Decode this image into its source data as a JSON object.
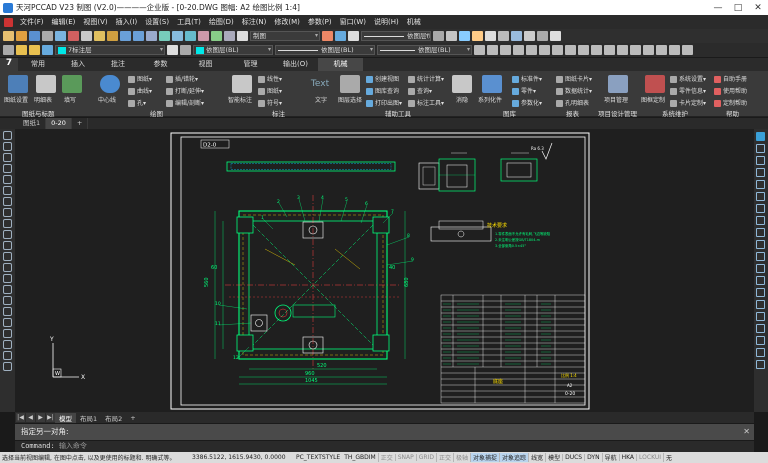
{
  "window": {
    "title": "天河PCCAD V23 制图 (V2.0)————企业版 - [0-20.DWG 图幅: A2 绘图比例 1:4]",
    "minimize": "—",
    "maximize": "□",
    "close": "✕"
  },
  "menu": [
    "文件(F)",
    "编辑(E)",
    "视图(V)",
    "插入(I)",
    "设置(S)",
    "工具(T)",
    "绘图(D)",
    "标注(N)",
    "修改(M)",
    "参数(P)",
    "窗口(W)",
    "说明(H)",
    "机械"
  ],
  "toolbar": {
    "layer_combo": "7标注层",
    "color_combo": "依图层(BL)",
    "linetype_combo": "依图层(BL)",
    "linetype2_combo": "依图层(BL)",
    "style_combo": "制图",
    "lineweight_combo": "依图层(BL)"
  },
  "ribbon_tabs": [
    "常用",
    "插入",
    "批注",
    "参数",
    "视图",
    "管理",
    "输出(O)",
    "机械"
  ],
  "ribbon_active_tab": "机械",
  "ribbon_groups": [
    {
      "label": "图纸与标题",
      "buttons": [
        {
          "label": "图纸设置"
        },
        {
          "label": "明细表"
        },
        {
          "label": "填写"
        }
      ]
    },
    {
      "label": "绘图",
      "buttons": [
        {
          "label": "中心线"
        }
      ],
      "small": [
        "图纸▾",
        "曲线▾",
        "孔▾",
        "插/错轮▾",
        "打断/延伸▾",
        "编辑/剖断▾"
      ]
    },
    {
      "label": "标注",
      "buttons": [
        {
          "label": "智能标注"
        },
        {
          "label": "文字"
        }
      ],
      "small": [
        "线性▾",
        "图纸▾",
        "符号▾"
      ]
    },
    {
      "label": "辅助工具",
      "buttons": [
        {
          "label": "图层选择"
        }
      ],
      "small": [
        "创建视图",
        "图库查询",
        "打印出图▾",
        "统计计算▾",
        "查询▾",
        "标注工具▾"
      ]
    },
    {
      "label": "图库",
      "buttons": [
        {
          "label": "消隐"
        },
        {
          "label": "系列化件"
        }
      ],
      "small": [
        "标准件▾",
        "零件▾",
        "参数化▾"
      ]
    },
    {
      "label": "报表",
      "small": [
        "图纸卡片▾",
        "数据统计▾",
        "孔明细表"
      ]
    },
    {
      "label": "项目设计管理",
      "buttons": [
        {
          "label": "项目管理"
        }
      ]
    },
    {
      "label": "系统维护",
      "buttons": [
        {
          "label": "图框定制"
        }
      ],
      "small": [
        "系统设置▾",
        "零件信息▾",
        "卡片定制▾"
      ]
    },
    {
      "label": "帮助",
      "small": [
        "自助手册",
        "使用帮助",
        "定制帮助"
      ]
    }
  ],
  "doc_tabs": [
    "图纸1",
    "0-20",
    "+"
  ],
  "doc_active_tab": "0-20",
  "layout_tabs": [
    "模型",
    "布局1",
    "布局2",
    "+"
  ],
  "layout_active_tab": "模型",
  "command": {
    "history": "指定另一对角:",
    "prompt": "Command:",
    "placeholder": "输入命令"
  },
  "status": {
    "hint": "选择当前视图编辑, 在图中点击, 以及更使用的标题和. 明确式等。",
    "coords": "3386.5122, 1615.9430, 0.0000",
    "text_style": "PC_TEXTSTYLE",
    "dim_style": "TH_GBDIM",
    "toggles": [
      {
        "label": "正交",
        "on": false
      },
      {
        "label": "SNAP",
        "on": false
      },
      {
        "label": "GRID",
        "on": false
      },
      {
        "label": "正交",
        "on": false
      },
      {
        "label": "极轴",
        "on": false
      },
      {
        "label": "对象捕捉",
        "on": true
      },
      {
        "label": "对象追踪",
        "on": true
      },
      {
        "label": "线宽",
        "on": false
      },
      {
        "label": "模型",
        "on": false
      },
      {
        "label": "DUCS",
        "on": false
      },
      {
        "label": "DYN",
        "on": false
      },
      {
        "label": "导航",
        "on": false
      },
      {
        "label": "HKA",
        "on": false
      },
      {
        "label": "LOCKUI",
        "on": false
      },
      {
        "label": "无",
        "on": false
      }
    ]
  },
  "drawing": {
    "view_label": "D2-0",
    "spec_title": "技术要求",
    "spec_lines": [
      "1.零件表面不允许有毛刺,飞边等缺陷",
      "2.未注明公差按GB/T1804-m",
      "3.全部倒角0.5×45°"
    ],
    "roughness": "Ra 6.3",
    "title_block_name": "底座",
    "drawing_number": "0-20",
    "scale_note": "比例 1:4",
    "sheet_label": "A2",
    "dim_labels": [
      "960",
      "1045",
      "560",
      "680",
      "520",
      "60",
      "40"
    ],
    "balloons": [
      "1",
      "2",
      "3",
      "4",
      "5",
      "6",
      "7",
      "8",
      "9",
      "10",
      "11",
      "12"
    ],
    "ucs_x": "X",
    "ucs_y": "Y",
    "ucs_w": "W"
  }
}
